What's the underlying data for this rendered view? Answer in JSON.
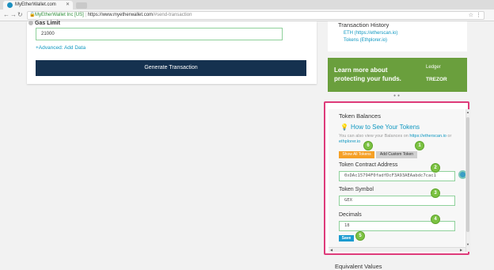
{
  "browser": {
    "tab_title": "MyEtherWallet.com",
    "secure_label": "MyEtherWallet Inc [US]",
    "url_domain": "https://www.myetherwallet.com",
    "url_path": "/#send-transaction"
  },
  "send_form": {
    "gas_label": "Gas Limit",
    "gas_value": "21000",
    "advanced_link": "+Advanced: Add Data",
    "generate_button": "Generate Transaction"
  },
  "history": {
    "title": "Transaction History",
    "links": [
      "ETH (https://etherscan.io)",
      "Tokens (Ethplorer.io)"
    ]
  },
  "ad": {
    "line1": "Learn more about",
    "line2": "protecting your funds.",
    "brand1": "Ledger",
    "brand2": "TREZOR"
  },
  "token_balances": {
    "title": "Token Balances",
    "how_link": "How to See Your Tokens",
    "also_prefix": "You can also view your Balances on ",
    "also_link1": "https://etherscan.io",
    "also_mid": " or ",
    "also_link2": "ethplorer.io",
    "show_all_button": "Show All Tokens",
    "add_custom_button": "Add Custom Token",
    "contract_label": "Token Contract Address",
    "contract_value": "0xDAc15794F0fadfDcF3A93AEAabdc7cac1",
    "symbol_label": "Token Symbol",
    "symbol_value": "GEX",
    "decimals_label": "Decimals",
    "decimals_value": "18",
    "save_button": "Save"
  },
  "steps": [
    "1",
    "2",
    "3",
    "4",
    "5",
    "6"
  ],
  "equivalent_values": "Equivalent Values",
  "colors": {
    "highlight_border": "#de3b7a",
    "step_green": "#7cc242",
    "link": "#0e97c0",
    "generate_bg": "#15314f",
    "ad_bg": "#6a9f3d",
    "show_all_bg": "#f5a025"
  }
}
